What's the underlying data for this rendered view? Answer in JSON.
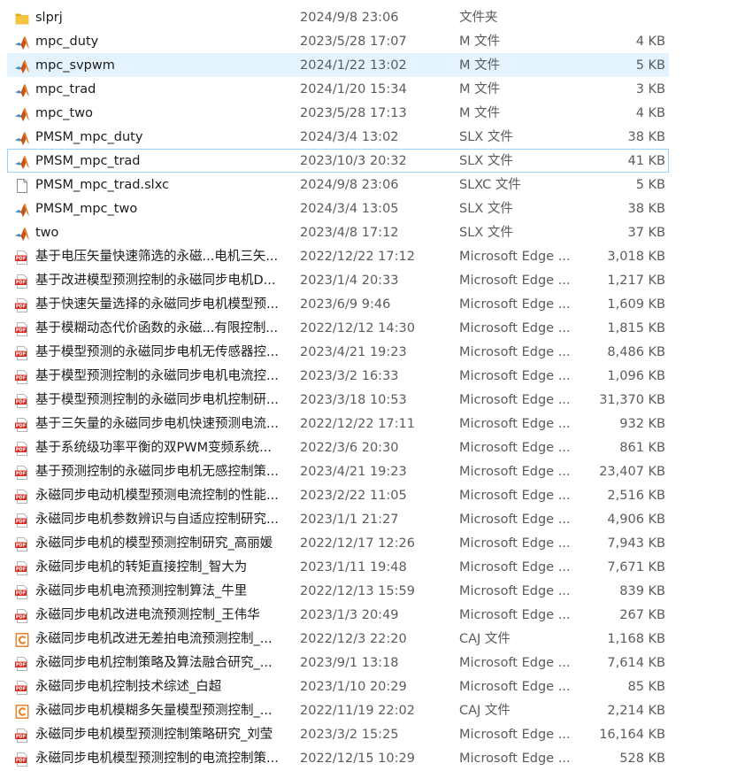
{
  "colors": {
    "selected_bg": "#e5f3ff",
    "focus_border": "#99d1ff",
    "pdf_red": "#d9261c",
    "caj_orange": "#e8832a",
    "folder_yellow": "#f5c342"
  },
  "files": [
    {
      "name": "slprj",
      "date": "2024/9/8 23:06",
      "type": "文件夹",
      "size": "",
      "icon": "folder-icon"
    },
    {
      "name": "mpc_duty",
      "date": "2023/5/28 17:07",
      "type": "M 文件",
      "size": "4 KB",
      "icon": "matlab-icon"
    },
    {
      "name": "mpc_svpwm",
      "date": "2024/1/22 13:02",
      "type": "M 文件",
      "size": "5 KB",
      "icon": "matlab-icon",
      "state": "selected"
    },
    {
      "name": "mpc_trad",
      "date": "2024/1/20 15:34",
      "type": "M 文件",
      "size": "3 KB",
      "icon": "matlab-icon"
    },
    {
      "name": "mpc_two",
      "date": "2023/5/28 17:13",
      "type": "M 文件",
      "size": "4 KB",
      "icon": "matlab-icon"
    },
    {
      "name": "PMSM_mpc_duty",
      "date": "2024/3/4 13:02",
      "type": "SLX 文件",
      "size": "38 KB",
      "icon": "matlab-icon"
    },
    {
      "name": "PMSM_mpc_trad",
      "date": "2023/10/3 20:32",
      "type": "SLX 文件",
      "size": "41 KB",
      "icon": "matlab-icon",
      "state": "focused"
    },
    {
      "name": "PMSM_mpc_trad.slxc",
      "date": "2024/9/8 23:06",
      "type": "SLXC 文件",
      "size": "5 KB",
      "icon": "blank-file-icon"
    },
    {
      "name": "PMSM_mpc_two",
      "date": "2024/3/4 13:05",
      "type": "SLX 文件",
      "size": "38 KB",
      "icon": "matlab-icon"
    },
    {
      "name": "two",
      "date": "2023/4/8 17:12",
      "type": "SLX 文件",
      "size": "37 KB",
      "icon": "matlab-icon"
    },
    {
      "name": "基于电压矢量快速筛选的永磁...电机三矢...",
      "date": "2022/12/22 17:12",
      "type": "Microsoft Edge ...",
      "size": "3,018 KB",
      "icon": "pdf-icon"
    },
    {
      "name": "基于改进模型预测控制的永磁同步电机D...",
      "date": "2023/1/4 20:33",
      "type": "Microsoft Edge ...",
      "size": "1,217 KB",
      "icon": "pdf-icon"
    },
    {
      "name": "基于快速矢量选择的永磁同步电机模型预...",
      "date": "2023/6/9 9:46",
      "type": "Microsoft Edge ...",
      "size": "1,609 KB",
      "icon": "pdf-icon"
    },
    {
      "name": "基于模糊动态代价函数的永磁...有限控制...",
      "date": "2022/12/12 14:30",
      "type": "Microsoft Edge ...",
      "size": "1,815 KB",
      "icon": "pdf-icon"
    },
    {
      "name": "基于模型预测的永磁同步电机无传感器控...",
      "date": "2023/4/21 19:23",
      "type": "Microsoft Edge ...",
      "size": "8,486 KB",
      "icon": "pdf-icon"
    },
    {
      "name": "基于模型预测控制的永磁同步电机电流控...",
      "date": "2023/3/2 16:33",
      "type": "Microsoft Edge ...",
      "size": "1,096 KB",
      "icon": "pdf-icon"
    },
    {
      "name": "基于模型预测控制的永磁同步电机控制研...",
      "date": "2023/3/18 10:53",
      "type": "Microsoft Edge ...",
      "size": "31,370 KB",
      "icon": "pdf-icon"
    },
    {
      "name": "基于三矢量的永磁同步电机快速预测电流...",
      "date": "2022/12/22 17:11",
      "type": "Microsoft Edge ...",
      "size": "932 KB",
      "icon": "pdf-icon"
    },
    {
      "name": "基于系统级功率平衡的双PWM变频系统...",
      "date": "2022/3/6 20:30",
      "type": "Microsoft Edge ...",
      "size": "861 KB",
      "icon": "pdf-icon"
    },
    {
      "name": "基于预测控制的永磁同步电机无感控制策...",
      "date": "2023/4/21 19:23",
      "type": "Microsoft Edge ...",
      "size": "23,407 KB",
      "icon": "pdf-icon"
    },
    {
      "name": "永磁同步电动机模型预测电流控制的性能...",
      "date": "2023/2/22 11:05",
      "type": "Microsoft Edge ...",
      "size": "2,516 KB",
      "icon": "pdf-icon"
    },
    {
      "name": "永磁同步电机参数辨识与自适应控制研究...",
      "date": "2023/1/1 21:27",
      "type": "Microsoft Edge ...",
      "size": "4,906 KB",
      "icon": "pdf-icon"
    },
    {
      "name": "永磁同步电机的模型预测控制研究_高丽媛",
      "date": "2022/12/17 12:26",
      "type": "Microsoft Edge ...",
      "size": "7,943 KB",
      "icon": "pdf-icon"
    },
    {
      "name": "永磁同步电机的转矩直接控制_智大为",
      "date": "2023/1/11 19:48",
      "type": "Microsoft Edge ...",
      "size": "7,671 KB",
      "icon": "pdf-icon"
    },
    {
      "name": "永磁同步电机电流预测控制算法_牛里",
      "date": "2022/12/13 15:59",
      "type": "Microsoft Edge ...",
      "size": "839 KB",
      "icon": "pdf-icon"
    },
    {
      "name": "永磁同步电机改进电流预测控制_王伟华",
      "date": "2023/1/3 20:49",
      "type": "Microsoft Edge ...",
      "size": "267 KB",
      "icon": "pdf-icon"
    },
    {
      "name": "永磁同步电机改进无差拍电流预测控制_...",
      "date": "2022/12/3 22:20",
      "type": "CAJ 文件",
      "size": "1,168 KB",
      "icon": "caj-icon"
    },
    {
      "name": "永磁同步电机控制策略及算法融合研究_...",
      "date": "2023/9/1 13:18",
      "type": "Microsoft Edge ...",
      "size": "7,614 KB",
      "icon": "pdf-icon"
    },
    {
      "name": "永磁同步电机控制技术综述_白超",
      "date": "2023/1/10 20:29",
      "type": "Microsoft Edge ...",
      "size": "85 KB",
      "icon": "pdf-icon"
    },
    {
      "name": "永磁同步电机模糊多矢量模型预测控制_...",
      "date": "2022/11/19 22:02",
      "type": "CAJ 文件",
      "size": "2,214 KB",
      "icon": "caj-icon"
    },
    {
      "name": "永磁同步电机模型预测控制策略研究_刘莹",
      "date": "2023/3/2 15:25",
      "type": "Microsoft Edge ...",
      "size": "16,164 KB",
      "icon": "pdf-icon"
    },
    {
      "name": "永磁同步电机模型预测控制的电流控制策...",
      "date": "2022/12/15 10:29",
      "type": "Microsoft Edge ...",
      "size": "528 KB",
      "icon": "pdf-icon"
    }
  ]
}
